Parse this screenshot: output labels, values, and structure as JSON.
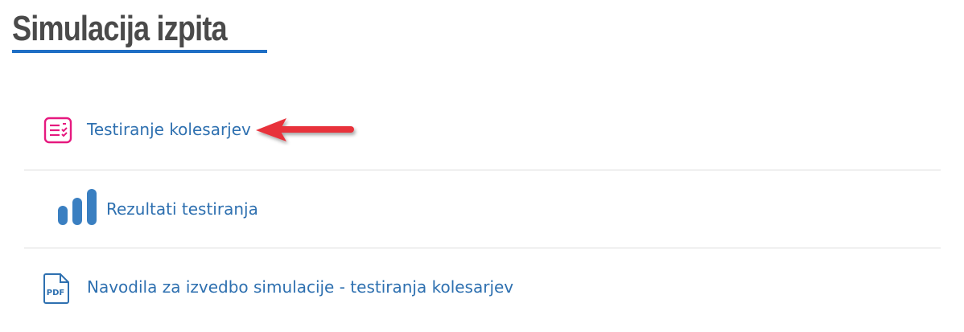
{
  "page": {
    "title": "Simulacija izpita"
  },
  "items": [
    {
      "label": "Testiranje kolesarjev",
      "icon": "quiz-icon"
    },
    {
      "label": "Rezultati testiranja",
      "icon": "bar-chart-icon"
    },
    {
      "label": "Navodila za izvedbo simulacije - testiranja kolesarjev",
      "icon": "pdf-file-icon",
      "icon_text": "PDF"
    }
  ],
  "colors": {
    "title": "#4a4a4a",
    "title_underline": "#1f6fc5",
    "link": "#2e70b0",
    "quiz_icon": "#e6197f",
    "chart_icon": "#3a7fc1",
    "pdf_icon": "#2e70b0",
    "annotation_arrow": "#e8323b",
    "divider": "#dcdcdc"
  }
}
